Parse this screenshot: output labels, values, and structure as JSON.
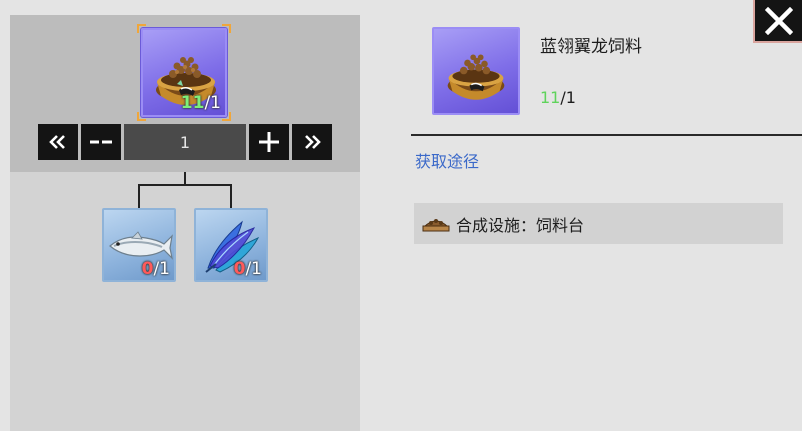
{
  "recipe": {
    "output": {
      "icon": "dino-feed-bowl-icon",
      "have": "11",
      "separator": "/",
      "need": "1"
    },
    "quantity": {
      "value": "1",
      "first_icon": "double-chevron-left-icon",
      "minus_icon": "minus-icon",
      "plus_icon": "plus-icon",
      "last_icon": "double-chevron-right-icon"
    },
    "ingredients": [
      {
        "icon": "fish-icon",
        "have": "0",
        "separator": "/",
        "need": "1"
      },
      {
        "icon": "blue-leaves-icon",
        "have": "0",
        "separator": "/",
        "need": "1"
      }
    ]
  },
  "detail": {
    "name": "蓝翎翼龙饲料",
    "have": "11",
    "separator": "/",
    "need": "1",
    "source_label": "获取途径",
    "facility_icon": "feed-trough-icon",
    "facility_label": "合成设施：饲料台"
  },
  "close_icon": "close-icon",
  "colors": {
    "rare_purple": "#7f6ee8",
    "common_blue": "#8cb2dc",
    "have_green": "#5fd35b",
    "lacking_red": "#ff5a5a",
    "link_blue": "#3b69c9",
    "selection_orange": "#f0a63a"
  }
}
